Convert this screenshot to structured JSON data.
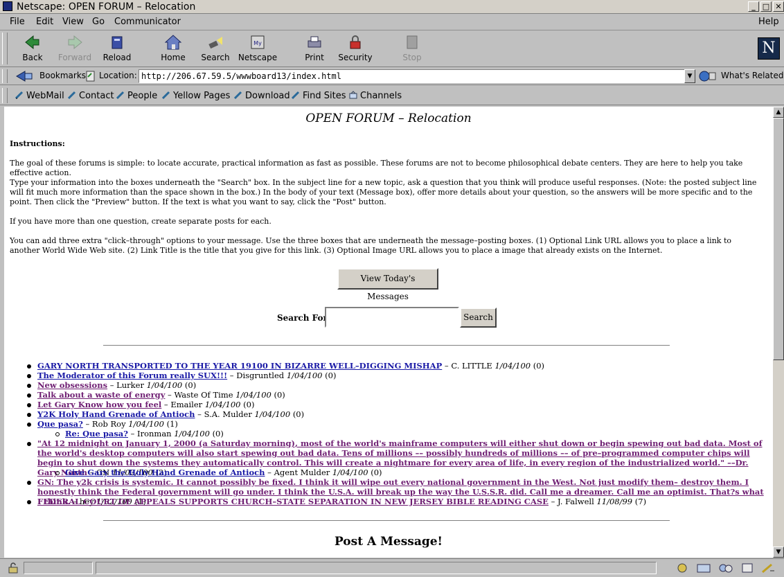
{
  "window": {
    "title": "Netscape: OPEN FORUM – Relocation"
  },
  "menu": [
    "File",
    "Edit",
    "View",
    "Go",
    "Communicator"
  ],
  "help_label": "Help",
  "toolbar": {
    "back": "Back",
    "forward": "Forward",
    "reload": "Reload",
    "home": "Home",
    "search": "Search",
    "netscape": "Netscape",
    "print": "Print",
    "security": "Security",
    "stop": "Stop"
  },
  "location": {
    "bookmarks": "Bookmarks",
    "label": "Location:",
    "url": "http://206.67.59.5/wwwboard13/index.html",
    "whats_related": "What's Related"
  },
  "personal": [
    "WebMail",
    "Contact",
    "People",
    "Yellow Pages",
    "Download",
    "Find Sites",
    "Channels"
  ],
  "page": {
    "title": "OPEN FORUM – Relocation",
    "instructions_heading": "Instructions:",
    "p1": "The goal of these forums is simple: to locate accurate, practical information as fast as possible. These forums are not to become philosophical debate centers. They are here to help you take effective action.",
    "p2": "Type your information into the boxes underneath the \"Search\" box. In the subject line for a new topic, ask a question that you think will produce useful responses. (Note: the posted subject line will fit much more information than the space shown in the box.) In the body of your text (Message box), offer more details about your question, so the answers will be more specific and to the point. Then click the \"Preview\" button. If the text is what you want to say, click the \"Post\" button.",
    "p3": "If you have more than one question, create separate posts for each.",
    "p4": "You can add three extra \"click–through\" options to your message. Use the three boxes that are underneath the message–posting boxes. (1) Optional Link URL allows you to place a link to another World Wide Web site. (2) Link Title is the title that you give for this link. (3) Optional Image URL allows you to place a image that already exists on the Internet.",
    "view_today": "View Today's Messages",
    "search_label": "Search For:",
    "search_value": "",
    "search_button": "Search",
    "post_heading": "Post A Message!"
  },
  "threads": [
    {
      "title": "GARY NORTH TRANSPORTED TO THE YEAR 19100 IN BIZARRE WELL–DIGGING MISHAP",
      "author": "C. LITTLE",
      "date": "1/04/100",
      "count": "(0)",
      "visited": false
    },
    {
      "title": "The Moderator of this Forum really SUX!!!",
      "author": "Disgruntled",
      "date": "1/04/100",
      "count": "(0)",
      "visited": false
    },
    {
      "title": "New obsessions",
      "author": "Lurker",
      "date": "1/04/100",
      "count": "(0)",
      "visited": true
    },
    {
      "title": "Talk about a waste of energy",
      "author": "Waste Of Time",
      "date": "1/04/100",
      "count": "(0)",
      "visited": true
    },
    {
      "title": "Let Gary Know how you feel",
      "author": "Emailer",
      "date": "1/04/100",
      "count": "(0)",
      "visited": true
    },
    {
      "title": "Y2K Holy Hand Grenade of Antioch",
      "author": "S.A. Mulder",
      "date": "1/04/100",
      "count": "(0)",
      "visited": false
    },
    {
      "title": "Que pasa?",
      "author": "Rob Roy",
      "date": "1/04/100",
      "count": "(1)",
      "visited": false
    },
    {
      "title": "Re: Que pasa?",
      "author": "Ironman",
      "date": "1/04/100",
      "count": "(0)",
      "visited": false
    },
    {
      "title": "\"At 12 midnight on January 1, 2000 (a Saturday morning), most of the world's mainframe computers will either shut down or begin spewing out bad data. Most of the world's desktop computers will also start spewing out bad data. Tens of millions –– possibly hundreds of millions –– of pre–programmed computer chips will begin to shut down the systems they automatically control. This will create a nightmare for every area of life, in every region of the industrialized world.\" ––Dr. Gary North",
      "author": "GN",
      "date": "11/02/100",
      "count": "(2)",
      "visited": true
    },
    {
      "title": "Give Gary the Holy Hand Grenade of Antioch",
      "author": "Agent Mulder",
      "date": "1/04/100",
      "count": "(0)",
      "visited": false
    },
    {
      "title": "GN: The y2k crisis is systemic. It cannot possibly be fixed. I think it will wipe out every national government in the West. Not just modify them– destroy them. I honestly think the Federal government will go under. I think the U.S.A. will break up the way the U.S.S.R. did. Call me a dreamer. Call me an optimist. That?s what I think.",
      "author": "hey",
      "date": "1/02/100",
      "count": "(1)",
      "visited": true
    },
    {
      "title": "FEDERAL COURT OF APPEALS SUPPORTS CHURCH–STATE SEPARATION IN NEW JERSEY BIBLE READING CASE",
      "author": "J. Falwell",
      "date": "11/08/99",
      "count": "(7)",
      "visited": true
    }
  ]
}
